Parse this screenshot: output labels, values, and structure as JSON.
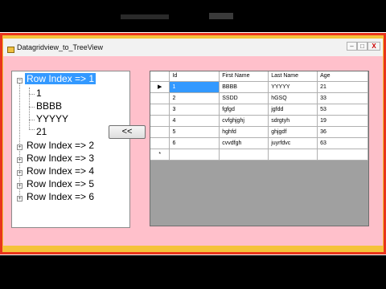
{
  "window": {
    "title": "Datagridview_to_TreeView",
    "minimize": "–",
    "maximize": "□",
    "close": "X"
  },
  "tree": {
    "nodes": [
      {
        "label": "Row Index => 1",
        "expanded": true,
        "selected": true,
        "children": [
          "1",
          "BBBB",
          "YYYYY",
          "21"
        ]
      },
      {
        "label": "Row Index => 2"
      },
      {
        "label": "Row Index => 3"
      },
      {
        "label": "Row Index => 4"
      },
      {
        "label": "Row Index => 5"
      },
      {
        "label": "Row Index => 6"
      }
    ]
  },
  "transfer_button": "<<",
  "grid": {
    "columns": [
      "Id",
      "First Name",
      "Last Name",
      "Age"
    ],
    "rows": [
      [
        "1",
        "BBBB",
        "YYYYY",
        "21"
      ],
      [
        "2",
        "SSDD",
        "hGSQ",
        "33"
      ],
      [
        "3",
        "fgfgd",
        "jgfdd",
        "53"
      ],
      [
        "4",
        "cvfghjghj",
        "sdrgtyh",
        "19"
      ],
      [
        "5",
        "hghfd",
        "ghjgdf",
        "36"
      ],
      [
        "6",
        "cvvdfgh",
        "juyrfdvc",
        "63"
      ]
    ],
    "current_row_marker": "▶",
    "new_row_marker": "*"
  },
  "colors": {
    "client_bg": "#ffc0cb",
    "selection": "#3399ff",
    "grid_empty": "#a0a0a0",
    "outer_border_red": "#e8341c",
    "outer_border_yellow": "#f5c33a"
  }
}
